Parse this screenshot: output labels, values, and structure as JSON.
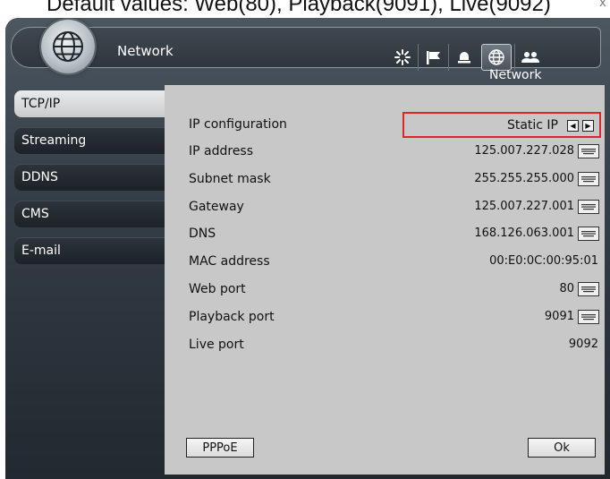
{
  "caption": "Default values: Web(80), Playback(9091), Live(9092)",
  "window": {
    "title": "Network",
    "subtitle": "Network",
    "close_glyph": "x"
  },
  "toolbar": {
    "icons": [
      "settings-icon",
      "flag-icon",
      "alarm-bell-icon",
      "network-globe-icon",
      "users-icon"
    ],
    "active": "network-globe-icon"
  },
  "tabs": [
    {
      "label": "TCP/IP",
      "active": true
    },
    {
      "label": "Streaming",
      "active": false
    },
    {
      "label": "DDNS",
      "active": false
    },
    {
      "label": "CMS",
      "active": false
    },
    {
      "label": "E-mail",
      "active": false
    }
  ],
  "fields": {
    "ip_configuration": {
      "label": "IP configuration",
      "value": "Static IP"
    },
    "ip_address": {
      "label": "IP address",
      "value": "125.007.227.028"
    },
    "subnet_mask": {
      "label": "Subnet mask",
      "value": "255.255.255.000"
    },
    "gateway": {
      "label": "Gateway",
      "value": "125.007.227.001"
    },
    "dns": {
      "label": "DNS",
      "value": "168.126.063.001"
    },
    "mac_address": {
      "label": "MAC address",
      "value": "00:E0:0C:00:95:01"
    },
    "web_port": {
      "label": "Web port",
      "value": "80"
    },
    "playback_port": {
      "label": "Playback port",
      "value": "9091"
    },
    "live_port": {
      "label": "Live port",
      "value": "9092"
    }
  },
  "buttons": {
    "pppoe": "PPPoE",
    "ok": "Ok"
  },
  "colors": {
    "highlight": "#e0242a",
    "panel": "#c8c8c8",
    "window": "#36404a"
  }
}
